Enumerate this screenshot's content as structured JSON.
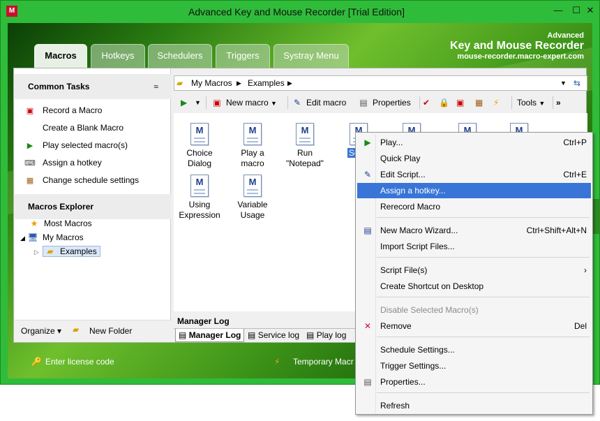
{
  "window": {
    "title": "Advanced Key and Mouse Recorder [Trial Edition]",
    "app_icon_letter": "M",
    "min": "—",
    "max": "☐",
    "close": "✕"
  },
  "brand": {
    "line1": "Advanced",
    "line2": "Key and Mouse Recorder",
    "line3": "mouse-recorder.macro-expert.com"
  },
  "tabs": [
    {
      "label": "Macros",
      "active": true
    },
    {
      "label": "Hotkeys"
    },
    {
      "label": "Schedulers"
    },
    {
      "label": "Triggers"
    },
    {
      "label": "Systray Menu"
    }
  ],
  "common_tasks": {
    "title": "Common Tasks",
    "collapse": "≈",
    "items": [
      {
        "label": "Record a Macro",
        "icon": "record-icon"
      },
      {
        "label": "Create a Blank Macro",
        "icon": ""
      },
      {
        "label": "Play selected macro(s)",
        "icon": "play-icon"
      },
      {
        "label": "Assign a hotkey",
        "icon": "keyboard-icon"
      },
      {
        "label": "Change schedule settings",
        "icon": "schedule-icon"
      }
    ]
  },
  "explorer": {
    "title": "Macros Explorer",
    "most_macros": "Most Macros",
    "my_macros": "My Macros",
    "examples": "Examples"
  },
  "left_bottom": {
    "organize": "Organize",
    "new_folder": "New Folder"
  },
  "address": {
    "root": "My Macros",
    "folder": "Examples"
  },
  "toolbar": {
    "new_macro": "New macro",
    "edit_macro": "Edit macro",
    "properties": "Properties",
    "tools": "Tools",
    "more": "»"
  },
  "files": [
    {
      "line1": "Choice",
      "line2": "Dialog"
    },
    {
      "line1": "Play a",
      "line2": "macro"
    },
    {
      "line1": "Run",
      "line2": "\"Notepad\""
    },
    {
      "line1": "Softp",
      "line2": ""
    },
    {
      "line1": "",
      "line2": ""
    },
    {
      "line1": "",
      "line2": ""
    },
    {
      "line1": "",
      "line2": ""
    },
    {
      "line1": "Using",
      "line2": "Expression"
    },
    {
      "line1": "Variable",
      "line2": "Usage"
    }
  ],
  "manager_log": {
    "title": "Manager Log",
    "tabs": [
      "Manager Log",
      "Service log",
      "Play log"
    ]
  },
  "statusbar": {
    "license": "Enter license code",
    "temp": "Temporary Macr"
  },
  "context_menu": [
    {
      "label": "Play...",
      "shortcut": "Ctrl+P",
      "icon": "play-icon"
    },
    {
      "label": "Quick Play",
      "shortcut": ""
    },
    {
      "label": "Edit Script...",
      "shortcut": "Ctrl+E",
      "icon": "edit-icon"
    },
    {
      "label": "Assign a hotkey...",
      "shortcut": "",
      "highlight": true
    },
    {
      "label": "Rerecord Macro",
      "shortcut": ""
    },
    {
      "label": "New Macro Wizard...",
      "shortcut": "Ctrl+Shift+Alt+N",
      "icon": "wizard-icon"
    },
    {
      "label": "Import Script Files...",
      "shortcut": ""
    },
    {
      "label": "Script File(s)",
      "shortcut": "›"
    },
    {
      "label": "Create Shortcut on Desktop",
      "shortcut": ""
    },
    {
      "label": "Disable Selected Macro(s)",
      "shortcut": "",
      "disabled": true
    },
    {
      "label": "Remove",
      "shortcut": "Del",
      "icon": "remove-icon"
    },
    {
      "label": "Schedule Settings...",
      "shortcut": ""
    },
    {
      "label": "Trigger Settings...",
      "shortcut": ""
    },
    {
      "label": "Properties...",
      "shortcut": "",
      "icon": "properties-icon"
    },
    {
      "label": "Refresh",
      "shortcut": ""
    }
  ]
}
